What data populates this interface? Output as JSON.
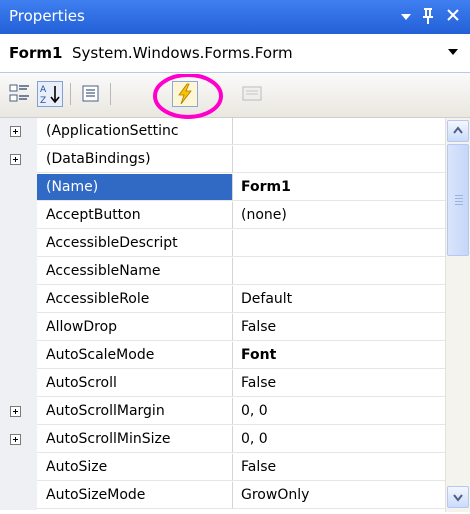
{
  "window": {
    "title": "Properties"
  },
  "object_selector": {
    "name": "Form1",
    "type": "System.Windows.Forms.Form"
  },
  "toolbar": {
    "buttons": [
      "categorized-icon",
      "alphabetical-icon",
      "properties-icon",
      "events-icon",
      "property-pages-icon"
    ],
    "highlighted": "events-icon",
    "highlight_color": "#ff00cc"
  },
  "grid": {
    "rows": [
      {
        "name": "(ApplicationSettinc",
        "value": "",
        "expandable": true
      },
      {
        "name": "(DataBindings)",
        "value": "",
        "expandable": true
      },
      {
        "name": "(Name)",
        "value": "Form1",
        "bold": true,
        "selected": true
      },
      {
        "name": "AcceptButton",
        "value": "(none)"
      },
      {
        "name": "AccessibleDescript",
        "value": ""
      },
      {
        "name": "AccessibleName",
        "value": ""
      },
      {
        "name": "AccessibleRole",
        "value": "Default"
      },
      {
        "name": "AllowDrop",
        "value": "False"
      },
      {
        "name": "AutoScaleMode",
        "value": "Font",
        "bold": true
      },
      {
        "name": "AutoScroll",
        "value": "False"
      },
      {
        "name": "AutoScrollMargin",
        "value": "0, 0",
        "expandable": true
      },
      {
        "name": "AutoScrollMinSize",
        "value": "0, 0",
        "expandable": true
      },
      {
        "name": "AutoSize",
        "value": "False"
      },
      {
        "name": "AutoSizeMode",
        "value": "GrowOnly"
      }
    ]
  },
  "colors": {
    "titlebar": "#2c68de",
    "selection": "#316ac5",
    "gutter": "#eef0f4"
  }
}
